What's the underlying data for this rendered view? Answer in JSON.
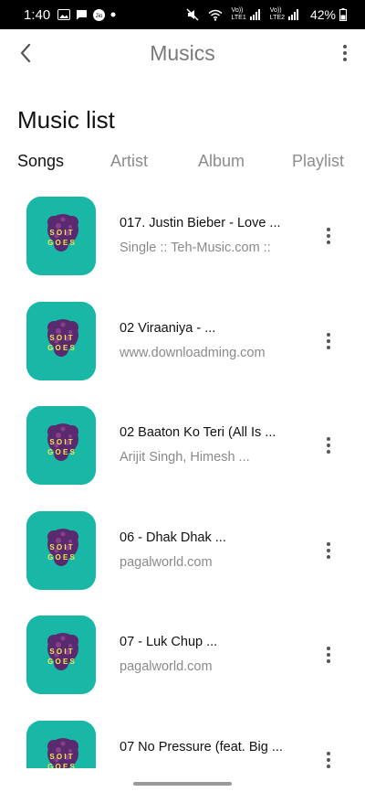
{
  "status_bar": {
    "time": "1:40",
    "net_label_1": "Vo))\nLTE1",
    "net_label_2": "Vo))\nLTE2",
    "battery": "42%"
  },
  "app_bar": {
    "title": "Musics"
  },
  "page_heading": "Music list",
  "tabs": [
    {
      "label": "Songs",
      "active": true
    },
    {
      "label": "Artist",
      "active": false
    },
    {
      "label": "Album",
      "active": false
    },
    {
      "label": "Playlist",
      "active": false
    }
  ],
  "songs": [
    {
      "title": "017. Justin Bieber - Love ...",
      "subtitle": "Single :: Teh-Music.com ::"
    },
    {
      "title": "02  Viraaniya - ...",
      "subtitle": "www.downloadming.com"
    },
    {
      "title": "02 Baaton Ko Teri (All Is ...",
      "subtitle": "Arijit Singh,  Himesh ..."
    },
    {
      "title": "06 - Dhak Dhak ...",
      "subtitle": "pagalworld.com"
    },
    {
      "title": "07 - Luk Chup ...",
      "subtitle": "pagalworld.com"
    },
    {
      "title": "07 No Pressure (feat. Big ...",
      "subtitle": ""
    }
  ],
  "album_art": {
    "line1": "S O I T",
    "line2": "G O E S"
  },
  "icons": {
    "status": [
      "image-icon",
      "message-icon",
      "jio-icon",
      "dot-icon",
      "mute-icon",
      "wifi-icon",
      "signal-icon",
      "battery-icon"
    ],
    "back": "back-arrow-icon",
    "more": "more-vertical-icon"
  },
  "colors": {
    "album_bg": "#19b8a6",
    "title_gray": "#7a7a7a",
    "text_dark": "#111111",
    "text_gray": "#8a8a8a"
  }
}
